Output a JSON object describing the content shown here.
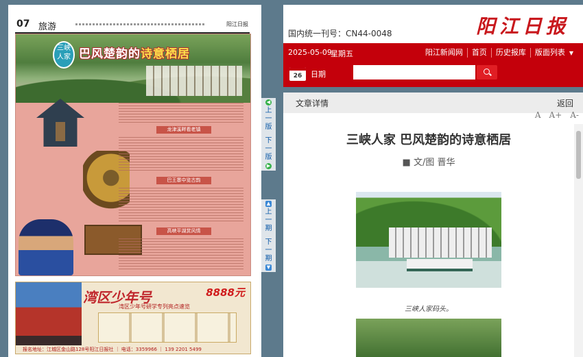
{
  "newspaper_page": {
    "page_number": "07",
    "section": "旅游",
    "masthead_small": "阳江日报",
    "feature_badge": "三峡人家",
    "feature_title_prefix": "巴风楚韵的",
    "feature_title_highlight": "诗意栖居",
    "sub_heads": [
      "龙津溪畔看老镇",
      "巴王寨中览古韵",
      "高峡平湖赏风情"
    ],
    "ad": {
      "title": "湾区少年号",
      "price": "8888元",
      "subtitle": "湾区少年号研学专列亮点速览",
      "footer": "报名地址：江城区金山路128号阳江日报社 ｜ 电话：3359966 ｜ 139 2201 5499"
    }
  },
  "side_nav": {
    "prev_page": [
      "上",
      "一",
      "版"
    ],
    "next_page": [
      "下",
      "一",
      "版"
    ],
    "prev_issue": [
      "上",
      "一",
      "期"
    ],
    "next_issue": [
      "下",
      "一",
      "期"
    ]
  },
  "reader": {
    "issn": "国内统一刊号：CN44-0048",
    "brand": "阳江日报",
    "date": "2025-05-09",
    "weekday": "星期五",
    "links": [
      "阳江新闻网",
      "首页",
      "历史报库",
      "版面列表"
    ],
    "calendar_day": "26",
    "date_label": "日期",
    "search_value": "",
    "detail_label": "文章详情",
    "back_label": "返回",
    "font_buttons": [
      "A",
      "A+",
      "A-"
    ],
    "article": {
      "title": "三峡人家 巴风楚韵的诗意栖居",
      "byline": "■ 文/图 晋华",
      "caption1": "三峡人家码头。"
    }
  },
  "colors": {
    "accent_red": "#c4000b",
    "brand_red": "#c8171c",
    "page_bg": "#5d7a8c"
  }
}
